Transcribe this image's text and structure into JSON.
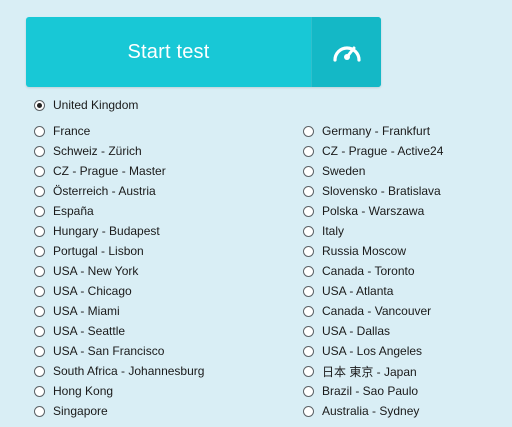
{
  "start_button": {
    "label": "Start test",
    "icon": "speedometer-icon",
    "color": "#18c8d6"
  },
  "servers": {
    "selected": "United Kingdom",
    "top": "United Kingdom",
    "left": [
      "France",
      "Schweiz - Zürich",
      "CZ - Prague - Master",
      "Österreich - Austria",
      "España",
      "Hungary - Budapest",
      "Portugal - Lisbon",
      "USA - New York",
      "USA - Chicago",
      "USA - Miami",
      "USA - Seattle",
      "USA - San Francisco",
      "South Africa - Johannesburg",
      "Hong Kong",
      "Singapore"
    ],
    "right": [
      "Germany - Frankfurt",
      "CZ - Prague - Active24",
      "Sweden",
      "Slovensko - Bratislava",
      "Polska - Warszawa",
      "Italy",
      "Russia Moscow",
      "Canada - Toronto",
      "USA - Atlanta",
      "Canada - Vancouver",
      "USA - Dallas",
      "USA - Los Angeles",
      "日本 東京 - Japan",
      "Brazil - Sao Paulo",
      "Australia - Sydney"
    ]
  }
}
